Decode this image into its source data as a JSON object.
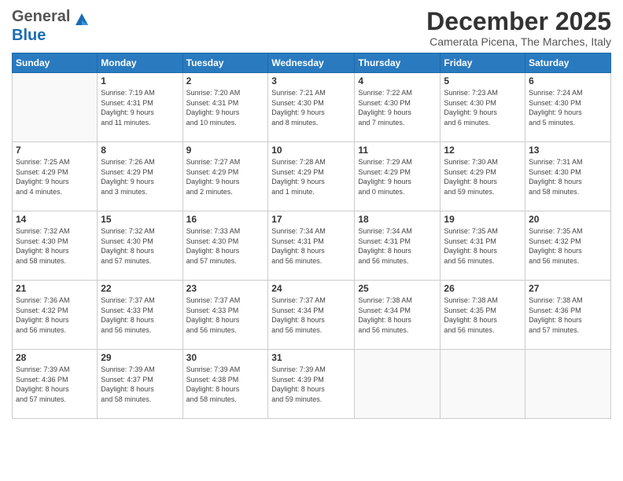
{
  "header": {
    "logo_general": "General",
    "logo_blue": "Blue",
    "month_title": "December 2025",
    "subtitle": "Camerata Picena, The Marches, Italy"
  },
  "weekdays": [
    "Sunday",
    "Monday",
    "Tuesday",
    "Wednesday",
    "Thursday",
    "Friday",
    "Saturday"
  ],
  "weeks": [
    [
      {
        "day": "",
        "info": ""
      },
      {
        "day": "1",
        "info": "Sunrise: 7:19 AM\nSunset: 4:31 PM\nDaylight: 9 hours\nand 11 minutes."
      },
      {
        "day": "2",
        "info": "Sunrise: 7:20 AM\nSunset: 4:31 PM\nDaylight: 9 hours\nand 10 minutes."
      },
      {
        "day": "3",
        "info": "Sunrise: 7:21 AM\nSunset: 4:30 PM\nDaylight: 9 hours\nand 8 minutes."
      },
      {
        "day": "4",
        "info": "Sunrise: 7:22 AM\nSunset: 4:30 PM\nDaylight: 9 hours\nand 7 minutes."
      },
      {
        "day": "5",
        "info": "Sunrise: 7:23 AM\nSunset: 4:30 PM\nDaylight: 9 hours\nand 6 minutes."
      },
      {
        "day": "6",
        "info": "Sunrise: 7:24 AM\nSunset: 4:30 PM\nDaylight: 9 hours\nand 5 minutes."
      }
    ],
    [
      {
        "day": "7",
        "info": "Sunrise: 7:25 AM\nSunset: 4:29 PM\nDaylight: 9 hours\nand 4 minutes."
      },
      {
        "day": "8",
        "info": "Sunrise: 7:26 AM\nSunset: 4:29 PM\nDaylight: 9 hours\nand 3 minutes."
      },
      {
        "day": "9",
        "info": "Sunrise: 7:27 AM\nSunset: 4:29 PM\nDaylight: 9 hours\nand 2 minutes."
      },
      {
        "day": "10",
        "info": "Sunrise: 7:28 AM\nSunset: 4:29 PM\nDaylight: 9 hours\nand 1 minute."
      },
      {
        "day": "11",
        "info": "Sunrise: 7:29 AM\nSunset: 4:29 PM\nDaylight: 9 hours\nand 0 minutes."
      },
      {
        "day": "12",
        "info": "Sunrise: 7:30 AM\nSunset: 4:29 PM\nDaylight: 8 hours\nand 59 minutes."
      },
      {
        "day": "13",
        "info": "Sunrise: 7:31 AM\nSunset: 4:30 PM\nDaylight: 8 hours\nand 58 minutes."
      }
    ],
    [
      {
        "day": "14",
        "info": "Sunrise: 7:32 AM\nSunset: 4:30 PM\nDaylight: 8 hours\nand 58 minutes."
      },
      {
        "day": "15",
        "info": "Sunrise: 7:32 AM\nSunset: 4:30 PM\nDaylight: 8 hours\nand 57 minutes."
      },
      {
        "day": "16",
        "info": "Sunrise: 7:33 AM\nSunset: 4:30 PM\nDaylight: 8 hours\nand 57 minutes."
      },
      {
        "day": "17",
        "info": "Sunrise: 7:34 AM\nSunset: 4:31 PM\nDaylight: 8 hours\nand 56 minutes."
      },
      {
        "day": "18",
        "info": "Sunrise: 7:34 AM\nSunset: 4:31 PM\nDaylight: 8 hours\nand 56 minutes."
      },
      {
        "day": "19",
        "info": "Sunrise: 7:35 AM\nSunset: 4:31 PM\nDaylight: 8 hours\nand 56 minutes."
      },
      {
        "day": "20",
        "info": "Sunrise: 7:35 AM\nSunset: 4:32 PM\nDaylight: 8 hours\nand 56 minutes."
      }
    ],
    [
      {
        "day": "21",
        "info": "Sunrise: 7:36 AM\nSunset: 4:32 PM\nDaylight: 8 hours\nand 56 minutes."
      },
      {
        "day": "22",
        "info": "Sunrise: 7:37 AM\nSunset: 4:33 PM\nDaylight: 8 hours\nand 56 minutes."
      },
      {
        "day": "23",
        "info": "Sunrise: 7:37 AM\nSunset: 4:33 PM\nDaylight: 8 hours\nand 56 minutes."
      },
      {
        "day": "24",
        "info": "Sunrise: 7:37 AM\nSunset: 4:34 PM\nDaylight: 8 hours\nand 56 minutes."
      },
      {
        "day": "25",
        "info": "Sunrise: 7:38 AM\nSunset: 4:34 PM\nDaylight: 8 hours\nand 56 minutes."
      },
      {
        "day": "26",
        "info": "Sunrise: 7:38 AM\nSunset: 4:35 PM\nDaylight: 8 hours\nand 56 minutes."
      },
      {
        "day": "27",
        "info": "Sunrise: 7:38 AM\nSunset: 4:36 PM\nDaylight: 8 hours\nand 57 minutes."
      }
    ],
    [
      {
        "day": "28",
        "info": "Sunrise: 7:39 AM\nSunset: 4:36 PM\nDaylight: 8 hours\nand 57 minutes."
      },
      {
        "day": "29",
        "info": "Sunrise: 7:39 AM\nSunset: 4:37 PM\nDaylight: 8 hours\nand 58 minutes."
      },
      {
        "day": "30",
        "info": "Sunrise: 7:39 AM\nSunset: 4:38 PM\nDaylight: 8 hours\nand 58 minutes."
      },
      {
        "day": "31",
        "info": "Sunrise: 7:39 AM\nSunset: 4:39 PM\nDaylight: 8 hours\nand 59 minutes."
      },
      {
        "day": "",
        "info": ""
      },
      {
        "day": "",
        "info": ""
      },
      {
        "day": "",
        "info": ""
      }
    ]
  ]
}
